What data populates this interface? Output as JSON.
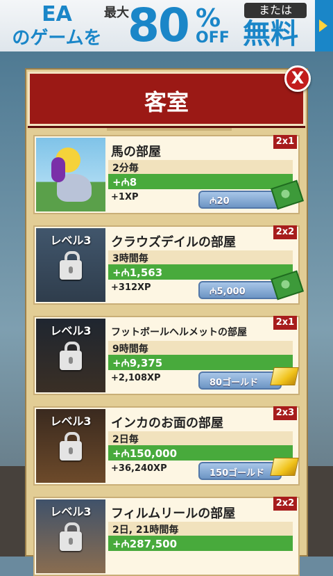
{
  "ad": {
    "brand_line1": "EA",
    "brand_line2": "のゲームを",
    "max_label": "最大",
    "percent_value": "80",
    "percent_sign": "%",
    "off_label": "OFF",
    "or_label": "または",
    "free_label": "無料"
  },
  "dialog": {
    "title": "客室",
    "close_label": "X"
  },
  "rooms": [
    {
      "level": "",
      "name": "馬の部屋",
      "time": "2分毎",
      "income": "+₼8",
      "xp": "+1XP",
      "price": "₼20",
      "multiplier": "2x1",
      "currency": "cash",
      "locked": false
    },
    {
      "level": "レベル3",
      "name": "クラウズデイルの部屋",
      "time": "3時間毎",
      "income": "+₼1,563",
      "xp": "+312XP",
      "price": "₼5,000",
      "multiplier": "2x2",
      "currency": "cash",
      "locked": true
    },
    {
      "level": "レベル3",
      "name": "フットボールヘルメットの部屋",
      "time": "9時間毎",
      "income": "+₼9,375",
      "xp": "+2,108XP",
      "price": "80ゴールド",
      "multiplier": "2x1",
      "currency": "gold",
      "locked": true
    },
    {
      "level": "レベル3",
      "name": "インカのお面の部屋",
      "time": "2日毎",
      "income": "+₼150,000",
      "xp": "+36,240XP",
      "price": "150ゴールド",
      "multiplier": "2x3",
      "currency": "gold",
      "locked": true
    },
    {
      "level": "レベル3",
      "name": "フィルムリールの部屋",
      "time": "2日, 21時間毎",
      "income": "+₼287,500",
      "xp": "",
      "price": "",
      "multiplier": "2x2",
      "currency": "gold",
      "locked": true
    }
  ]
}
